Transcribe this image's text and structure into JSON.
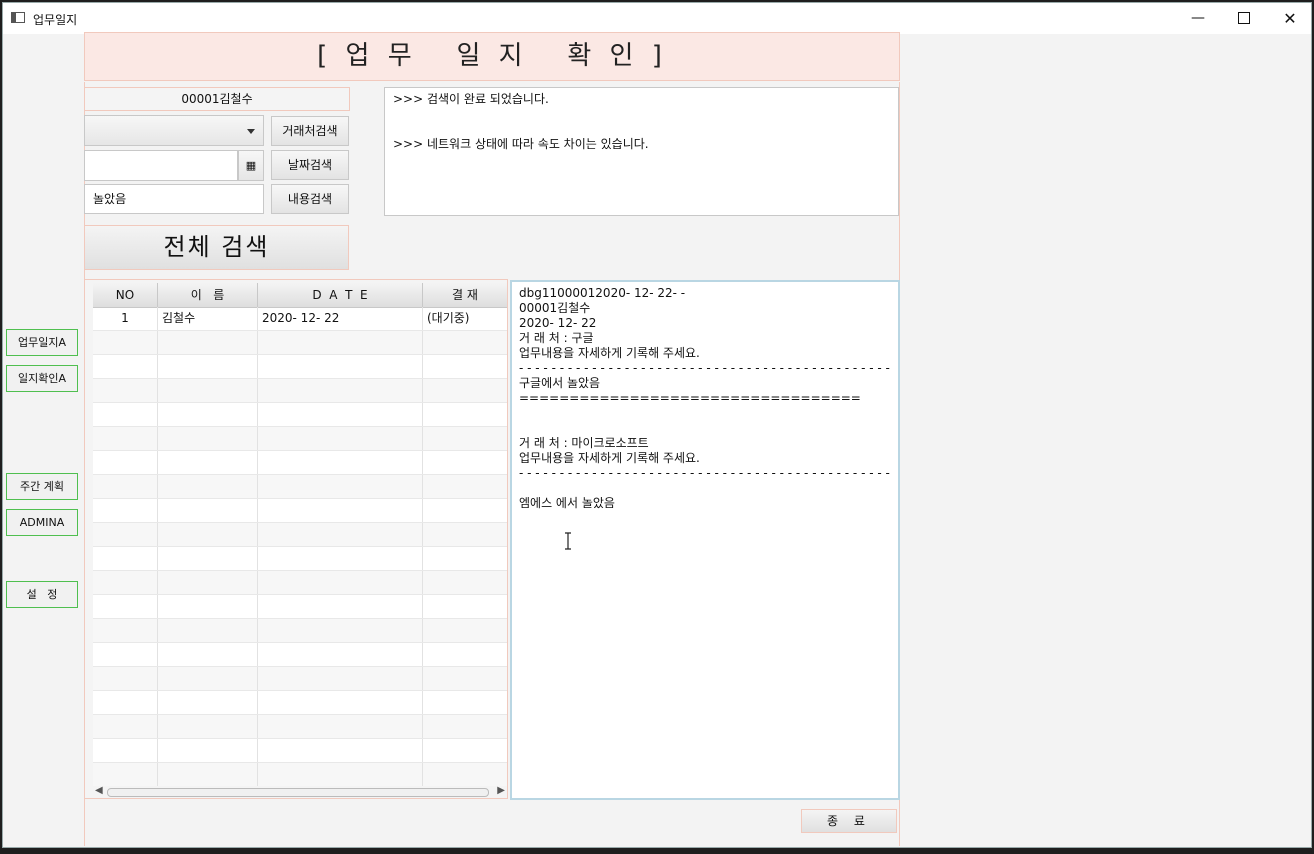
{
  "window": {
    "title": "업무일지",
    "minimize_icon": "minimize-icon",
    "maximize_icon": "maximize-icon",
    "close_icon": "close-icon"
  },
  "header": {
    "title": "[ 업 무   일 지   확 인 ]"
  },
  "sidebar": {
    "buttons": [
      "업무일지A",
      "일지확인A",
      "주간 계획",
      "ADMINA",
      "설   정"
    ]
  },
  "filters": {
    "user_label": "00001김철수",
    "combo_value": "",
    "date_value": "",
    "calendar_icon": "calendar-icon",
    "content_value": "놀았음",
    "btn_client": "거래처검색",
    "btn_date": "날짜검색",
    "btn_content": "내용검색",
    "btn_all": "전체 검색"
  },
  "log": {
    "lines": [
      ">>> 검색이 완료 되었습니다.",
      ">>> 네트워크 상태에 따라 속도 차이는 있습니다."
    ]
  },
  "table": {
    "headers": [
      "NO",
      "이   름",
      "D  A  T  E",
      "결 재"
    ],
    "rows": [
      {
        "no": "1",
        "name": "김철수",
        "date": "2020- 12- 22",
        "status": "(대기중)"
      }
    ]
  },
  "detail": {
    "lines": [
      "dbg11000012020- 12- 22- -",
      "00001김철수",
      "2020- 12- 22",
      "거 래 처 : 구글",
      "업무내용을 자세하게 기록해 주세요.",
      "- - - - - - - - - - - - - - - - - - - - - - - - - - - - - - - - - - - - - - - - - - - - - - -",
      "구글에서 놀았음",
      "==================================",
      "",
      "",
      "거 래 처 : 마이크로소프트",
      "업무내용을 자세하게 기록해 주세요.",
      "- - - - - - - - - - - - - - - - - - - - - - - - - - - - - - - - - - - - - - - - - - - - - - -",
      "",
      "엠에스 에서 놀았음"
    ]
  },
  "footer": {
    "close_label": "종 료"
  }
}
